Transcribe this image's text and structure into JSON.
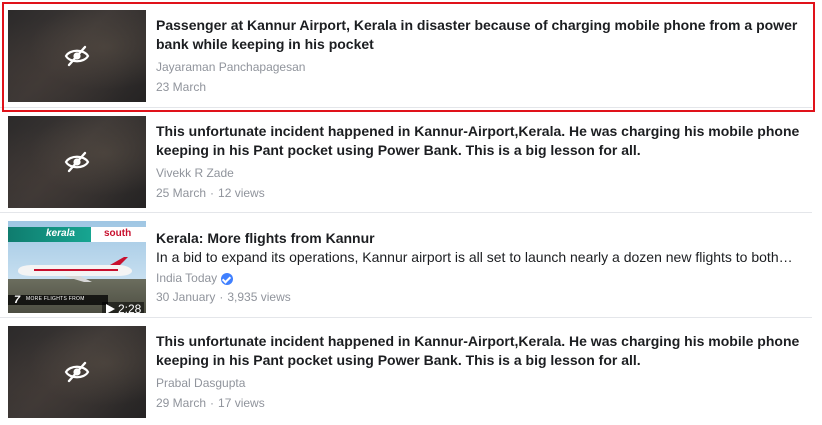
{
  "videos": [
    {
      "title": "Passenger at Kannur Airport, Kerala in disaster because of charging mobile phone from a power bank while keeping in his pocket",
      "author": "Jayaraman Panchapagesan",
      "date": "23 March",
      "views": ""
    },
    {
      "title": "This unfortunate incident happened in Kannur-Airport,Kerala. He was charging his mobile phone keeping in his Pant pocket using Power Bank. This is a big lesson for all.",
      "author": "Vivekk R Zade",
      "date": "25 March",
      "views": "12 views"
    },
    {
      "title": "Kerala: More flights from Kannur",
      "description": "In a bid to expand its operations, Kannur airport is all set to launch nearly a dozen new flights to both…",
      "author": "India Today",
      "date": "30 January",
      "views": "3,935 views",
      "duration": "2:28",
      "thumb_banner_left": "kerala",
      "thumb_banner_right": "south",
      "thumb_lower_number": "7",
      "thumb_lower_text": "MORE FLIGHTS FROM"
    },
    {
      "title": "This unfortunate incident happened in Kannur-Airport,Kerala. He was charging his mobile phone keeping in his Pant pocket using Power Bank. This is a big lesson for all.",
      "author": "Prabal Dasgupta",
      "date": "29 March",
      "views": "17 views"
    }
  ],
  "separator": "·",
  "colors": {
    "highlight": "#e0121a",
    "verified": "#4080ff",
    "meta_text": "#90949c",
    "title_text": "#1c1e21"
  },
  "icons": {
    "hidden": "eye-slash-icon",
    "verified": "verified-badge-icon",
    "play": "play-icon"
  }
}
